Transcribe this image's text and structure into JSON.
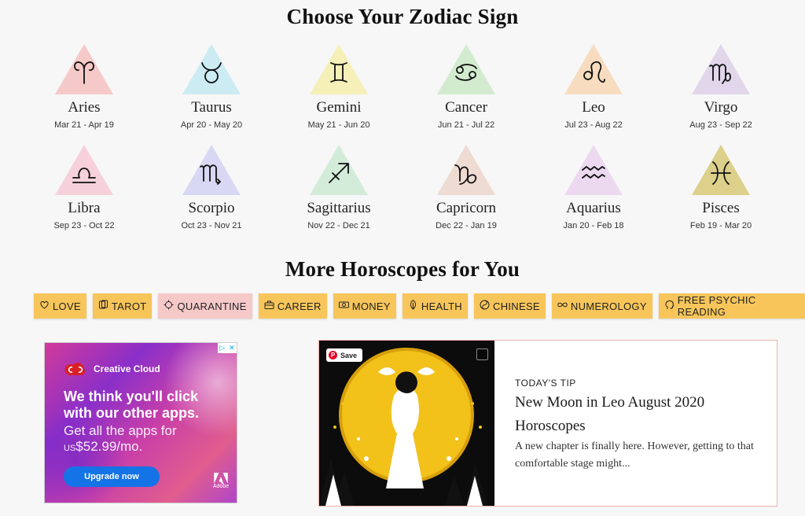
{
  "headings": {
    "choose": "Choose Your Zodiac Sign",
    "more": "More Horoscopes for You"
  },
  "signs": [
    {
      "name": "Aries",
      "dates": "Mar 21 - Apr 19",
      "color": "#f6c9c9",
      "icon": "aries-icon"
    },
    {
      "name": "Taurus",
      "dates": "Apr 20 - May 20",
      "color": "#ccebf2",
      "icon": "taurus-icon"
    },
    {
      "name": "Gemini",
      "dates": "May 21 - Jun 20",
      "color": "#f5f0b8",
      "icon": "gemini-icon"
    },
    {
      "name": "Cancer",
      "dates": "Jun 21 - Jul 22",
      "color": "#d2ebcf",
      "icon": "cancer-icon"
    },
    {
      "name": "Leo",
      "dates": "Jul 23 - Aug 22",
      "color": "#f7dcc0",
      "icon": "leo-icon"
    },
    {
      "name": "Virgo",
      "dates": "Aug 23 - Sep 22",
      "color": "#e1d6ea",
      "icon": "virgo-icon"
    },
    {
      "name": "Libra",
      "dates": "Sep 23 - Oct 22",
      "color": "#f6d1dc",
      "icon": "libra-icon"
    },
    {
      "name": "Scorpio",
      "dates": "Oct 23 - Nov 21",
      "color": "#d8d8f4",
      "icon": "scorpio-icon"
    },
    {
      "name": "Sagittarius",
      "dates": "Nov 22 - Dec 21",
      "color": "#d2ecd9",
      "icon": "sagittarius-icon"
    },
    {
      "name": "Capricorn",
      "dates": "Dec 22 - Jan 19",
      "color": "#eedbd1",
      "icon": "capricorn-icon"
    },
    {
      "name": "Aquarius",
      "dates": "Jan 20 - Feb 18",
      "color": "#ecd9f0",
      "icon": "aquarius-icon"
    },
    {
      "name": "Pisces",
      "dates": "Feb 19 - Mar 20",
      "color": "#dcd08a",
      "icon": "pisces-icon"
    }
  ],
  "tags": [
    {
      "label": "LOVE",
      "icon": "heart-icon",
      "color": "#f7c55a"
    },
    {
      "label": "TAROT",
      "icon": "tarot-cards-icon",
      "color": "#f7c55a"
    },
    {
      "label": "QUARANTINE",
      "icon": "virus-icon",
      "color": "#f6c9c9"
    },
    {
      "label": "CAREER",
      "icon": "briefcase-icon",
      "color": "#f7c55a"
    },
    {
      "label": "MONEY",
      "icon": "money-icon",
      "color": "#f7c55a"
    },
    {
      "label": "HEALTH",
      "icon": "leaf-icon",
      "color": "#f7c55a"
    },
    {
      "label": "CHINESE",
      "icon": "yin-yang-icon",
      "color": "#f7c55a"
    },
    {
      "label": "NUMEROLOGY",
      "icon": "infinity-icon",
      "color": "#f7c55a"
    },
    {
      "label": "FREE PSYCHIC READING",
      "icon": "psychic-head-icon",
      "color": "#f7c55a"
    }
  ],
  "ad": {
    "brand": "Creative Cloud",
    "headline": "We think you'll click with our other apps.",
    "sub_line1": "Get all the apps for",
    "price_prefix": "US",
    "price": "$52.99/mo.",
    "button": "Upgrade now",
    "adobe": "Adobe"
  },
  "tip": {
    "save": "Save",
    "label": "TODAY'S TIP",
    "title": "New Moon in Leo August 2020 Horoscopes",
    "text": "A new chapter is finally here. However, getting to that comfortable stage might..."
  }
}
